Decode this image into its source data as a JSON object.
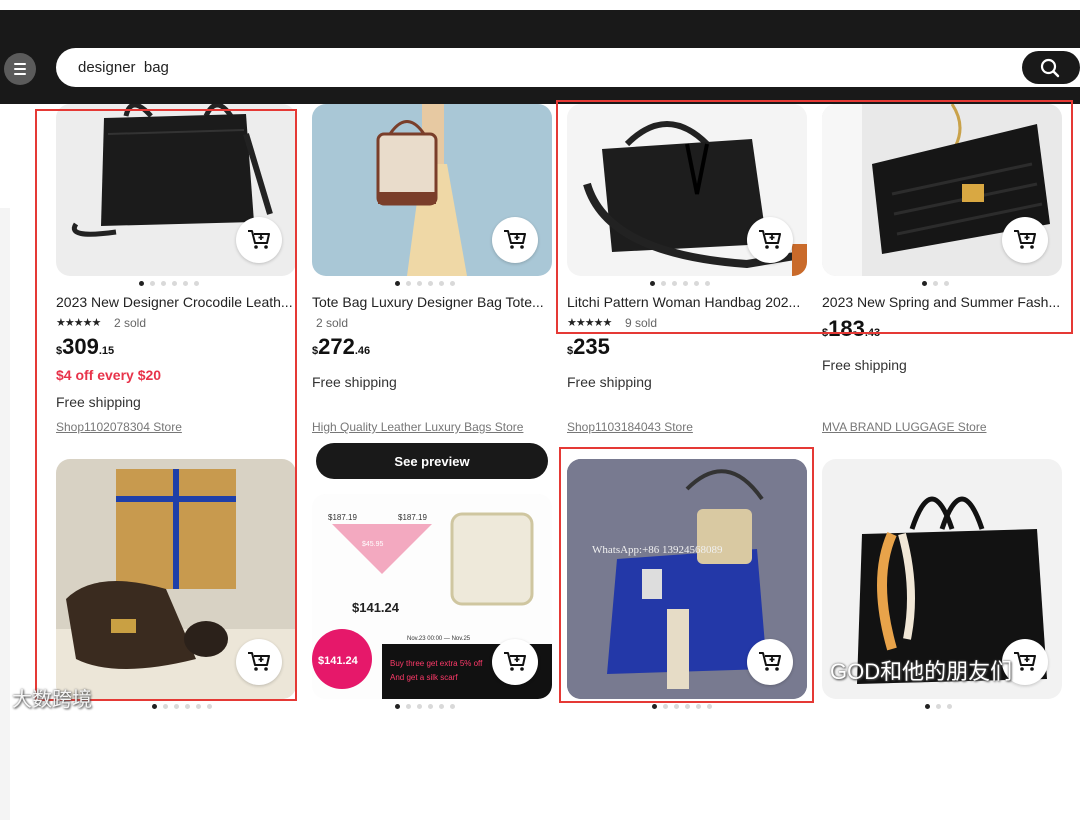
{
  "search": {
    "value": "designer  bag"
  },
  "icons": {
    "menu": "hamburger-icon",
    "search": "search-icon",
    "cart": "add-to-cart-icon"
  },
  "colors": {
    "header": "#191919",
    "promo": "#e8334a",
    "highlight": "#e53935"
  },
  "products": [
    {
      "title": "2023 New Designer Crocodile Leath...",
      "stars": "★★★★★",
      "sold": "2 sold",
      "currency": "$",
      "price_int": "309",
      "price_dec": ".15",
      "promo": "$4 off every $20",
      "shipping": "Free shipping",
      "store": "Shop1102078304 Store"
    },
    {
      "title": "Tote Bag Luxury Designer Bag Tote...",
      "stars": "",
      "sold": "2 sold",
      "currency": "$",
      "price_int": "272",
      "price_dec": ".46",
      "promo": "",
      "shipping": "Free shipping",
      "store": "High Quality Leather Luxury Bags Store",
      "preview": "See preview"
    },
    {
      "title": "Litchi Pattern Woman Handbag 202...",
      "stars": "★★★★★",
      "sold": "9 sold",
      "currency": "$",
      "price_int": "235",
      "price_dec": "",
      "promo": "",
      "shipping": "Free shipping",
      "store": "Shop1103184043 Store"
    },
    {
      "title": "2023 New Spring and Summer Fash...",
      "stars": "",
      "sold": "",
      "currency": "$",
      "price_int": "183",
      "price_dec": ".43",
      "promo": "",
      "shipping": "Free shipping",
      "store": "MVA BRAND LUGGAGE Store"
    }
  ],
  "ad_image_text": {
    "old_price_left": "$187.19",
    "old_price_right": "$187.19",
    "discount": "$45.95",
    "final_price": "$141.24",
    "circle_price": "$141.24",
    "offer": "Buy three get extra 5% off",
    "gift": "And get a silk scarf",
    "dates": "Nov.23 00:00 — Nov.25"
  },
  "image_watermark": "WhatsApp:+86 13924568089",
  "watermarks": {
    "left": "大数跨境",
    "right": "GOD和他的朋友们"
  }
}
